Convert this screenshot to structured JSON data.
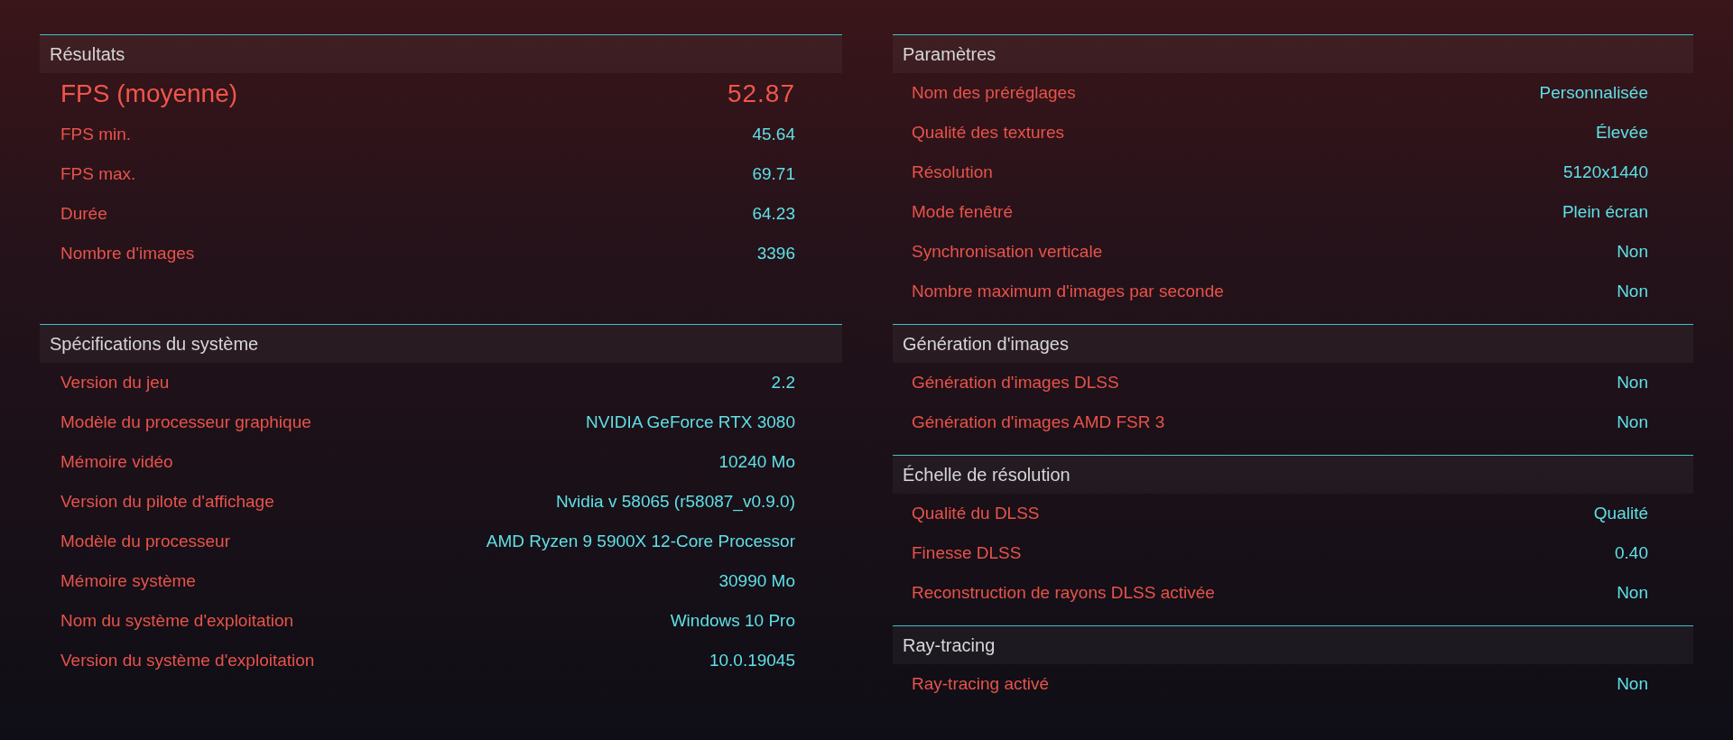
{
  "left": [
    {
      "title": "Résultats",
      "rows": [
        {
          "label": "FPS (moyenne)",
          "value": "52.87",
          "kind": "highlight"
        },
        {
          "label": "FPS min.",
          "value": "45.64",
          "kind": "normal"
        },
        {
          "label": "FPS max.",
          "value": "69.71",
          "kind": "normal"
        },
        {
          "label": "Durée",
          "value": "64.23",
          "kind": "normal"
        },
        {
          "label": "Nombre d'images",
          "value": "3396",
          "kind": "normal"
        }
      ]
    },
    {
      "title": "Spécifications du système",
      "rows": [
        {
          "label": "Version du jeu",
          "value": "2.2"
        },
        {
          "label": "Modèle du processeur graphique",
          "value": "NVIDIA GeForce RTX 3080"
        },
        {
          "label": "Mémoire vidéo",
          "value": "10240 Mo"
        },
        {
          "label": "Version du pilote d'affichage",
          "value": "Nvidia v 58065 (r58087_v0.9.0)"
        },
        {
          "label": "Modèle du processeur",
          "value": "AMD Ryzen 9 5900X 12-Core Processor"
        },
        {
          "label": "Mémoire système",
          "value": "30990 Mo"
        },
        {
          "label": "Nom du système d'exploitation",
          "value": "Windows 10 Pro"
        },
        {
          "label": "Version du système d'exploitation",
          "value": "10.0.19045"
        }
      ]
    }
  ],
  "right": [
    {
      "title": "Paramètres",
      "rows": [
        {
          "label": "Nom des préréglages",
          "value": "Personnalisée"
        },
        {
          "label": "Qualité des textures",
          "value": "Élevée"
        },
        {
          "label": "Résolution",
          "value": "5120x1440"
        },
        {
          "label": "Mode fenêtré",
          "value": "Plein écran"
        },
        {
          "label": "Synchronisation verticale",
          "value": "Non"
        },
        {
          "label": "Nombre maximum d'images par seconde",
          "value": "Non"
        }
      ]
    },
    {
      "title": "Génération d'images",
      "rows": [
        {
          "label": "Génération d'images DLSS",
          "value": "Non"
        },
        {
          "label": "Génération d'images AMD FSR 3",
          "value": "Non"
        }
      ]
    },
    {
      "title": "Échelle de résolution",
      "rows": [
        {
          "label": "Qualité du DLSS",
          "value": "Qualité"
        },
        {
          "label": "Finesse DLSS",
          "value": "0.40"
        },
        {
          "label": "Reconstruction de rayons DLSS activée",
          "value": "Non"
        }
      ]
    },
    {
      "title": "Ray-tracing",
      "rows": [
        {
          "label": "Ray-tracing activé",
          "value": "Non"
        }
      ]
    }
  ]
}
